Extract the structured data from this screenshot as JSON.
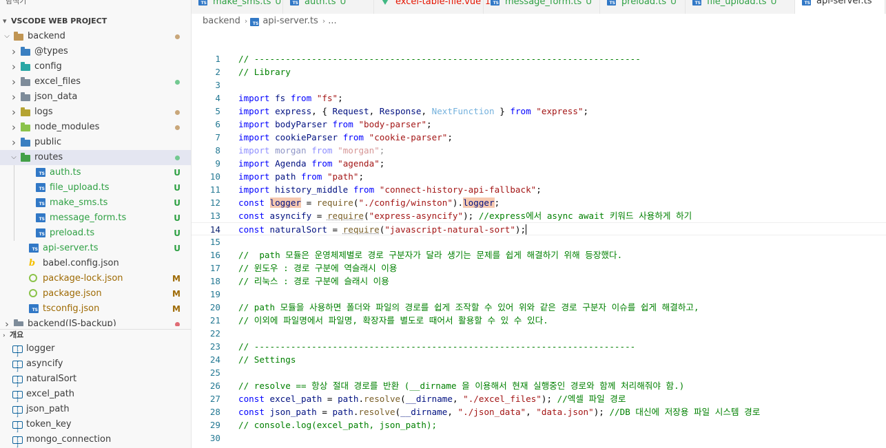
{
  "sidebar": {
    "title": "탐색기",
    "more": "···",
    "project_name": "VSCODE WEB PROJECT",
    "tree": [
      {
        "label": "backend",
        "type": "folder",
        "open": true,
        "depth": 0,
        "badge": "",
        "dot": "#c9a77a",
        "color": "#c09553",
        "icon": "folder-icon"
      },
      {
        "label": "@types",
        "type": "folder",
        "open": false,
        "depth": 1,
        "badge": "",
        "dot": "",
        "color": "#3a7fc1",
        "icon": "types-folder-icon"
      },
      {
        "label": "config",
        "type": "folder",
        "open": false,
        "depth": 1,
        "badge": "",
        "dot": "",
        "color": "#2aa7a5",
        "icon": "config-folder-icon"
      },
      {
        "label": "excel_files",
        "type": "folder",
        "open": false,
        "depth": 1,
        "badge": "",
        "dot": "#73c991",
        "color": "#7e8c9a",
        "icon": "folder-icon"
      },
      {
        "label": "json_data",
        "type": "folder",
        "open": false,
        "depth": 1,
        "badge": "",
        "dot": "",
        "color": "#7e8c9a",
        "icon": "folder-icon"
      },
      {
        "label": "logs",
        "type": "folder",
        "open": false,
        "depth": 1,
        "badge": "",
        "dot": "#c9a77a",
        "color": "#b5a332",
        "icon": "logs-folder-icon"
      },
      {
        "label": "node_modules",
        "type": "folder",
        "open": false,
        "depth": 1,
        "badge": "",
        "dot": "#c9a77a",
        "color": "#8bc34a",
        "icon": "node-modules-folder-icon"
      },
      {
        "label": "public",
        "type": "folder",
        "open": false,
        "depth": 1,
        "badge": "",
        "dot": "",
        "color": "#3a7fc1",
        "icon": "public-folder-icon"
      },
      {
        "label": "routes",
        "type": "folder",
        "open": true,
        "depth": 1,
        "badge": "",
        "dot": "#73c991",
        "color": "#43a047",
        "icon": "routes-folder-icon",
        "selected": true
      },
      {
        "label": "auth.ts",
        "type": "ts",
        "depth": 2,
        "badge": "U",
        "color": "#3178c6",
        "icon": "typescript-icon"
      },
      {
        "label": "file_upload.ts",
        "type": "ts",
        "depth": 2,
        "badge": "U",
        "color": "#3178c6",
        "icon": "typescript-icon"
      },
      {
        "label": "make_sms.ts",
        "type": "ts",
        "depth": 2,
        "badge": "U",
        "color": "#3178c6",
        "icon": "typescript-icon"
      },
      {
        "label": "message_form.ts",
        "type": "ts",
        "depth": 2,
        "badge": "U",
        "color": "#3178c6",
        "icon": "typescript-icon"
      },
      {
        "label": "preload.ts",
        "type": "ts",
        "depth": 2,
        "badge": "U",
        "color": "#3178c6",
        "icon": "typescript-icon"
      },
      {
        "label": "api-server.ts",
        "type": "ts",
        "depth": 1,
        "badge": "U",
        "color": "#3178c6",
        "icon": "typescript-icon"
      },
      {
        "label": "babel.config.json",
        "type": "babel",
        "depth": 1,
        "badge": "",
        "color": "#f5c000",
        "icon": "babel-icon"
      },
      {
        "label": "package-lock.json",
        "type": "json",
        "depth": 1,
        "badge": "M",
        "color": "#8bc34a",
        "icon": "nodejs-icon"
      },
      {
        "label": "package.json",
        "type": "json",
        "depth": 1,
        "badge": "M",
        "color": "#8bc34a",
        "icon": "nodejs-icon"
      },
      {
        "label": "tsconfig.json",
        "type": "tsconfig",
        "depth": 1,
        "badge": "M",
        "color": "#3178c6",
        "icon": "tsconfig-icon"
      },
      {
        "label": "backend(JS-backup)",
        "type": "folder",
        "open": false,
        "depth": 0,
        "badge": "",
        "dot": "#e06c75",
        "color": "#7e8c9a",
        "icon": "folder-icon",
        "partial": true
      }
    ],
    "badge_colors": {
      "U": "#2ea043",
      "M": "#9e6a03"
    }
  },
  "outline": {
    "header": "개요",
    "items": [
      "logger",
      "asyncify",
      "naturalSort",
      "excel_path",
      "json_path",
      "token_key",
      "mongo_connection"
    ]
  },
  "tabs": [
    {
      "label": "make_sms.ts",
      "mark": "U",
      "icon": "typescript-icon",
      "mark_color": "#2ea043"
    },
    {
      "label": "auth.ts",
      "mark": "U",
      "icon": "typescript-icon",
      "mark_color": "#2ea043"
    },
    {
      "label": "excel-table-file.vue",
      "mark": "1",
      "icon": "vue-icon",
      "mark_color": "#e51400",
      "label_color": "#e51400"
    },
    {
      "label": "message_form.ts",
      "mark": "U",
      "icon": "typescript-icon",
      "mark_color": "#2ea043"
    },
    {
      "label": "preload.ts",
      "mark": "U",
      "icon": "typescript-icon",
      "mark_color": "#2ea043"
    },
    {
      "label": "file_upload.ts",
      "mark": "U",
      "icon": "typescript-icon",
      "mark_color": "#2ea043"
    },
    {
      "label": "api-server.ts",
      "mark": "",
      "icon": "typescript-icon",
      "active": true
    }
  ],
  "breadcrumb": [
    "backend",
    "api-server.ts",
    "..."
  ],
  "editor": {
    "current_line": 14,
    "lines": [
      {
        "n": 1,
        "t": [
          [
            "c",
            "// --------------------------------------------------------------------------"
          ]
        ]
      },
      {
        "n": 2,
        "t": [
          [
            "c",
            "// Library"
          ]
        ]
      },
      {
        "n": 3,
        "t": []
      },
      {
        "n": 4,
        "t": [
          [
            "k",
            "import"
          ],
          [
            "p",
            " "
          ],
          [
            "id",
            "fs"
          ],
          [
            "p",
            " "
          ],
          [
            "k",
            "from"
          ],
          [
            "p",
            " "
          ],
          [
            "s",
            "\"fs\""
          ],
          [
            "p",
            ";"
          ]
        ]
      },
      {
        "n": 5,
        "t": [
          [
            "k",
            "import"
          ],
          [
            "p",
            " "
          ],
          [
            "id",
            "express"
          ],
          [
            "p",
            ", { "
          ],
          [
            "id",
            "Request"
          ],
          [
            "p",
            ", "
          ],
          [
            "id",
            "Response"
          ],
          [
            "p",
            ", "
          ],
          [
            "u",
            "NextFunction"
          ],
          [
            "p",
            " } "
          ],
          [
            "k",
            "from"
          ],
          [
            "p",
            " "
          ],
          [
            "s",
            "\"express\""
          ],
          [
            "p",
            ";"
          ]
        ]
      },
      {
        "n": 6,
        "t": [
          [
            "k",
            "import"
          ],
          [
            "p",
            " "
          ],
          [
            "id",
            "bodyParser"
          ],
          [
            "p",
            " "
          ],
          [
            "k",
            "from"
          ],
          [
            "p",
            " "
          ],
          [
            "s",
            "\"body-parser\""
          ],
          [
            "p",
            ";"
          ]
        ]
      },
      {
        "n": 7,
        "t": [
          [
            "k",
            "import"
          ],
          [
            "p",
            " "
          ],
          [
            "id",
            "cookieParser"
          ],
          [
            "p",
            " "
          ],
          [
            "k",
            "from"
          ],
          [
            "p",
            " "
          ],
          [
            "s",
            "\"cookie-parser\""
          ],
          [
            "p",
            ";"
          ]
        ]
      },
      {
        "n": 8,
        "dim": true,
        "t": [
          [
            "k",
            "import"
          ],
          [
            "p",
            " "
          ],
          [
            "id",
            "morgan"
          ],
          [
            "p",
            " "
          ],
          [
            "k",
            "from"
          ],
          [
            "p",
            " "
          ],
          [
            "s",
            "\"morgan\""
          ],
          [
            "p",
            ";"
          ]
        ]
      },
      {
        "n": 9,
        "t": [
          [
            "k",
            "import"
          ],
          [
            "p",
            " "
          ],
          [
            "id",
            "Agenda"
          ],
          [
            "p",
            " "
          ],
          [
            "k",
            "from"
          ],
          [
            "p",
            " "
          ],
          [
            "s",
            "\"agenda\""
          ],
          [
            "p",
            ";"
          ]
        ]
      },
      {
        "n": 10,
        "t": [
          [
            "k",
            "import"
          ],
          [
            "p",
            " "
          ],
          [
            "id",
            "path"
          ],
          [
            "p",
            " "
          ],
          [
            "k",
            "from"
          ],
          [
            "p",
            " "
          ],
          [
            "s",
            "\"path\""
          ],
          [
            "p",
            ";"
          ]
        ]
      },
      {
        "n": 11,
        "t": [
          [
            "k",
            "import"
          ],
          [
            "p",
            " "
          ],
          [
            "id",
            "history_middle"
          ],
          [
            "p",
            " "
          ],
          [
            "k",
            "from"
          ],
          [
            "p",
            " "
          ],
          [
            "s",
            "\"connect-history-api-fallback\""
          ],
          [
            "p",
            ";"
          ]
        ]
      },
      {
        "n": 12,
        "t": [
          [
            "k",
            "const"
          ],
          [
            "p",
            " "
          ],
          [
            "id hl",
            "logger"
          ],
          [
            "p",
            " = "
          ],
          [
            "f",
            "require"
          ],
          [
            "p",
            "("
          ],
          [
            "s",
            "\"./config/winston\""
          ],
          [
            "p",
            ")."
          ],
          [
            "id hl",
            "logger"
          ],
          [
            "p",
            ";"
          ]
        ]
      },
      {
        "n": 13,
        "t": [
          [
            "k",
            "const"
          ],
          [
            "p",
            " "
          ],
          [
            "id",
            "asyncify"
          ],
          [
            "p",
            " = "
          ],
          [
            "f squig",
            "require"
          ],
          [
            "p",
            "("
          ],
          [
            "s",
            "\"express-asyncify\""
          ],
          [
            "p",
            "); "
          ],
          [
            "c",
            "//express에서 async await 키워드 사용하게 하기"
          ]
        ]
      },
      {
        "n": 14,
        "t": [
          [
            "k",
            "const"
          ],
          [
            "p",
            " "
          ],
          [
            "id",
            "naturalSort"
          ],
          [
            "p",
            " = "
          ],
          [
            "f squig",
            "require"
          ],
          [
            "p",
            "("
          ],
          [
            "s",
            "\"javascript-natural-sort\""
          ],
          [
            "p",
            ");"
          ]
        ],
        "cursor": true
      },
      {
        "n": 15,
        "t": []
      },
      {
        "n": 16,
        "t": [
          [
            "c",
            "//  path 모듈은 운영체제별로 경로 구분자가 달라 생기는 문제를 쉽게 해결하기 위해 등장했다."
          ]
        ]
      },
      {
        "n": 17,
        "t": [
          [
            "c",
            "// 윈도우 : 경로 구분에 역슬래시 이용"
          ]
        ]
      },
      {
        "n": 18,
        "t": [
          [
            "c",
            "// 리눅스 : 경로 구분에 슬래시 이용"
          ]
        ]
      },
      {
        "n": 19,
        "t": []
      },
      {
        "n": 20,
        "t": [
          [
            "c",
            "// path 모듈을 사용하면 폴더와 파일의 경로를 쉽게 조작할 수 있어 위와 같은 경로 구분자 이슈를 쉽게 해결하고,"
          ]
        ]
      },
      {
        "n": 21,
        "t": [
          [
            "c",
            "// 이외에 파일명에서 파일명, 확장자를 별도로 때어서 활용할 수 있 수 있다."
          ]
        ]
      },
      {
        "n": 22,
        "t": []
      },
      {
        "n": 23,
        "t": [
          [
            "c",
            "// -------------------------------------------------------------------------"
          ]
        ]
      },
      {
        "n": 24,
        "t": [
          [
            "c",
            "// Settings"
          ]
        ]
      },
      {
        "n": 25,
        "t": []
      },
      {
        "n": 26,
        "t": [
          [
            "c",
            "// resolve == 항상 절대 경로를 반환 (__dirname 을 이용해서 현재 실행중인 경로와 함께 처리해줘야 함.)"
          ]
        ]
      },
      {
        "n": 27,
        "t": [
          [
            "k",
            "const"
          ],
          [
            "p",
            " "
          ],
          [
            "id",
            "excel_path"
          ],
          [
            "p",
            " = "
          ],
          [
            "id",
            "path"
          ],
          [
            "p",
            "."
          ],
          [
            "f",
            "resolve"
          ],
          [
            "p",
            "("
          ],
          [
            "id",
            "__dirname"
          ],
          [
            "p",
            ", "
          ],
          [
            "s",
            "\"./excel_files\""
          ],
          [
            "p",
            "); "
          ],
          [
            "c",
            "//엑셀 파일 경로"
          ]
        ]
      },
      {
        "n": 28,
        "t": [
          [
            "k",
            "const"
          ],
          [
            "p",
            " "
          ],
          [
            "id",
            "json_path"
          ],
          [
            "p",
            " = "
          ],
          [
            "id",
            "path"
          ],
          [
            "p",
            "."
          ],
          [
            "f",
            "resolve"
          ],
          [
            "p",
            "("
          ],
          [
            "id",
            "__dirname"
          ],
          [
            "p",
            ", "
          ],
          [
            "s",
            "\"./json_data\""
          ],
          [
            "p",
            ", "
          ],
          [
            "s",
            "\"data.json\""
          ],
          [
            "p",
            "); "
          ],
          [
            "c",
            "//DB 대신에 저장용 파일 시스템 경로"
          ]
        ]
      },
      {
        "n": 29,
        "t": [
          [
            "c",
            "// console.log(excel_path, json_path);"
          ]
        ]
      },
      {
        "n": 30,
        "t": []
      }
    ]
  }
}
